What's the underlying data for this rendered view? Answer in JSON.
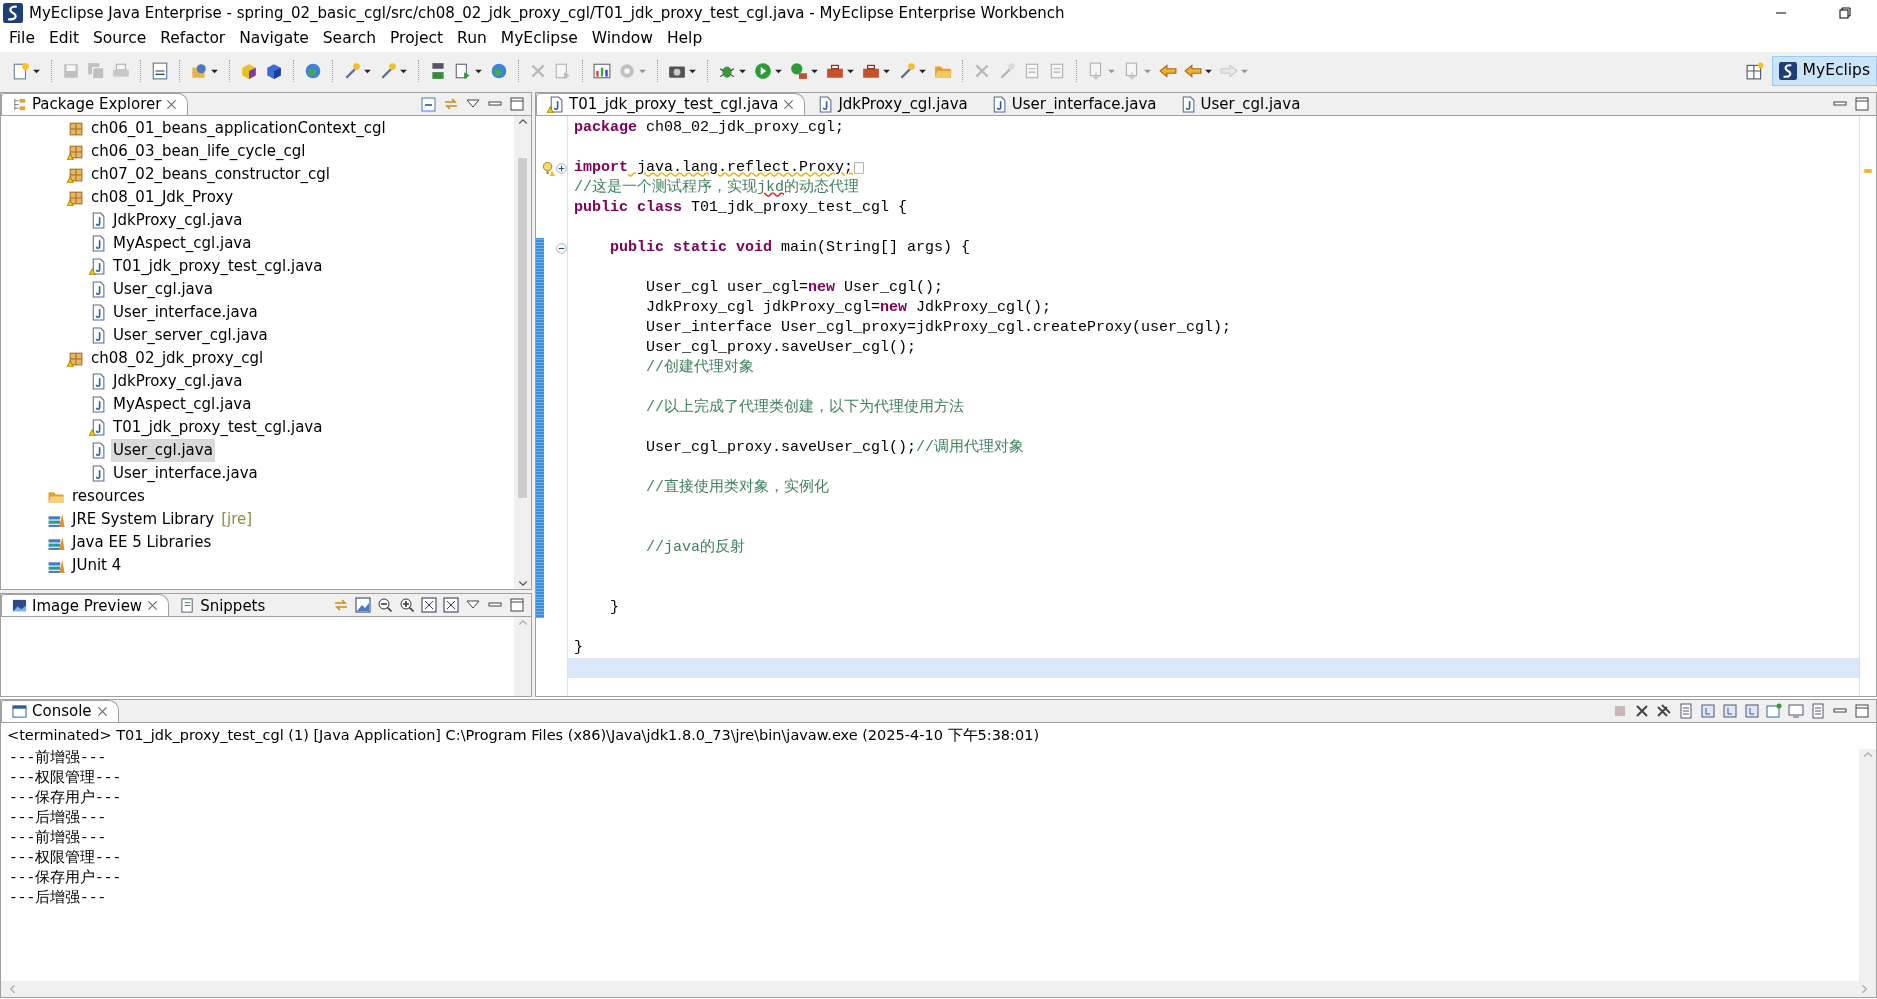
{
  "window": {
    "title": "MyEclipse Java Enterprise - spring_02_basic_cgl/src/ch08_02_jdk_proxy_cgl/T01_jdk_proxy_test_cgl.java - MyEclipse Enterprise Workbench"
  },
  "menu": [
    "File",
    "Edit",
    "Source",
    "Refactor",
    "Navigate",
    "Search",
    "Project",
    "Run",
    "MyEclipse",
    "Window",
    "Help"
  ],
  "toolbar": [
    {
      "kind": "new",
      "disabled": false,
      "dropdown": true
    },
    {
      "kind": "separator"
    },
    {
      "kind": "save",
      "disabled": true,
      "dropdown": false
    },
    {
      "kind": "saveall",
      "disabled": true,
      "dropdown": false
    },
    {
      "kind": "print",
      "disabled": true,
      "dropdown": false
    },
    {
      "kind": "separator"
    },
    {
      "kind": "binary",
      "disabled": false,
      "dropdown": false
    },
    {
      "kind": "separator"
    },
    {
      "kind": "project",
      "disabled": false,
      "dropdown": true
    },
    {
      "kind": "separator"
    },
    {
      "kind": "cube",
      "disabled": false,
      "dropdown": false
    },
    {
      "kind": "cubeblue",
      "disabled": false,
      "dropdown": false
    },
    {
      "kind": "separator"
    },
    {
      "kind": "globe",
      "disabled": false,
      "dropdown": false
    },
    {
      "kind": "separator"
    },
    {
      "kind": "wand",
      "disabled": false,
      "dropdown": true
    },
    {
      "kind": "wand",
      "disabled": false,
      "dropdown": true
    },
    {
      "kind": "separator"
    },
    {
      "kind": "server",
      "disabled": false,
      "dropdown": false
    },
    {
      "kind": "deploy",
      "disabled": false,
      "dropdown": true
    },
    {
      "kind": "globe",
      "disabled": false,
      "dropdown": false
    },
    {
      "kind": "separator"
    },
    {
      "kind": "cut",
      "disabled": true,
      "dropdown": false
    },
    {
      "kind": "deploy",
      "disabled": true,
      "dropdown": false
    },
    {
      "kind": "separator"
    },
    {
      "kind": "chart",
      "disabled": false,
      "dropdown": false
    },
    {
      "kind": "gear",
      "disabled": true,
      "dropdown": true
    },
    {
      "kind": "separator"
    },
    {
      "kind": "camera",
      "disabled": false,
      "dropdown": true
    },
    {
      "kind": "separator"
    },
    {
      "kind": "bug",
      "disabled": false,
      "dropdown": true
    },
    {
      "kind": "run",
      "disabled": false,
      "dropdown": true
    },
    {
      "kind": "runext",
      "disabled": false,
      "dropdown": true
    },
    {
      "kind": "tool",
      "disabled": false,
      "dropdown": true
    },
    {
      "kind": "tool",
      "disabled": false,
      "dropdown": true
    },
    {
      "kind": "wand",
      "disabled": false,
      "dropdown": true
    },
    {
      "kind": "folder",
      "disabled": false,
      "dropdown": false
    },
    {
      "kind": "separator"
    },
    {
      "kind": "cut",
      "disabled": true,
      "dropdown": false
    },
    {
      "kind": "wand",
      "disabled": true,
      "dropdown": false
    },
    {
      "kind": "box",
      "disabled": true,
      "dropdown": false
    },
    {
      "kind": "box",
      "disabled": true,
      "dropdown": false
    },
    {
      "kind": "separator"
    },
    {
      "kind": "annot",
      "disabled": true,
      "dropdown": true
    },
    {
      "kind": "annot",
      "disabled": true,
      "dropdown": true
    },
    {
      "kind": "back",
      "disabled": false,
      "dropdown": false
    },
    {
      "kind": "back",
      "disabled": false,
      "dropdown": true
    },
    {
      "kind": "forward",
      "disabled": true,
      "dropdown": true
    }
  ],
  "perspective": {
    "label": "MyEclips",
    "selected": true
  },
  "package_explorer": {
    "tab": {
      "label": "Package Explorer",
      "selected": true
    },
    "packages": [
      {
        "label": "ch06_01_beans_applicationContext_cgl",
        "warning": false,
        "selected": false
      },
      {
        "label": "ch06_03_bean_life_cycle_cgl",
        "warning": true,
        "selected": false
      },
      {
        "label": "ch07_02_beans_constructor_cgl",
        "warning": true,
        "selected": false
      },
      {
        "label": "ch08_01_Jdk_Proxy",
        "warning": true,
        "selected": false,
        "children": [
          {
            "label": "JdkProxy_cgl.java",
            "warning": false,
            "selected": false
          },
          {
            "label": "MyAspect_cgl.java",
            "warning": false,
            "selected": false
          },
          {
            "label": "T01_jdk_proxy_test_cgl.java",
            "warning": true,
            "selected": false
          },
          {
            "label": "User_cgl.java",
            "warning": false,
            "selected": false
          },
          {
            "label": "User_interface.java",
            "warning": false,
            "selected": false
          },
          {
            "label": "User_server_cgl.java",
            "warning": false,
            "selected": false
          }
        ]
      },
      {
        "label": "ch08_02_jdk_proxy_cgl",
        "warning": true,
        "selected": false,
        "children": [
          {
            "label": "JdkProxy_cgl.java",
            "warning": false,
            "selected": false
          },
          {
            "label": "MyAspect_cgl.java",
            "warning": false,
            "selected": false
          },
          {
            "label": "T01_jdk_proxy_test_cgl.java",
            "warning": true,
            "selected": false
          },
          {
            "label": "User_cgl.java",
            "warning": false,
            "selected": true
          },
          {
            "label": "User_interface.java",
            "warning": false,
            "selected": false
          }
        ]
      }
    ],
    "items": [
      {
        "label": "resources",
        "kind": "folder",
        "selected": false
      },
      {
        "label": "JRE System Library",
        "kind": "library",
        "decoration": "[jre]",
        "selected": false
      },
      {
        "label": "Java EE 5 Libraries",
        "kind": "library",
        "selected": false
      },
      {
        "label": "JUnit 4",
        "kind": "library",
        "selected": false
      }
    ]
  },
  "lower_left_tabs": [
    {
      "label": "Image Preview",
      "selected": true
    },
    {
      "label": "Snippets",
      "selected": false
    }
  ],
  "editor": {
    "tabs": [
      {
        "label": "T01_jdk_proxy_test_cgl.java",
        "selected": true,
        "warning": true
      },
      {
        "label": "JdkProxy_cgl.java",
        "selected": false,
        "warning": false
      },
      {
        "label": "User_interface.java",
        "selected": false,
        "warning": false
      },
      {
        "label": "User_cgl.java",
        "selected": false,
        "warning": false
      }
    ],
    "lines": [
      {
        "changed": false,
        "current": false,
        "segments": [
          {
            "text": "package",
            "kind": "keyword"
          },
          {
            "text": " ch08_02_jdk_proxy_cgl;",
            "kind": "plain"
          }
        ]
      },
      {
        "changed": false,
        "current": false
      },
      {
        "changed": false,
        "current": false,
        "warning": true,
        "foldable": true,
        "collapsed": true,
        "segments": [
          {
            "text": "import",
            "kind": "keyword"
          },
          {
            "text": " java.lang.reflect.Proxy;",
            "kind": "plain",
            "warning": true
          }
        ]
      },
      {
        "changed": false,
        "current": false,
        "segments": [
          {
            "text": "//这是一个测试程序，实现",
            "kind": "comment"
          },
          {
            "text": "jkd",
            "kind": "comment",
            "misspelled": true
          },
          {
            "text": "的动态代理",
            "kind": "comment"
          }
        ]
      },
      {
        "changed": false,
        "current": false,
        "segments": [
          {
            "text": "public",
            "kind": "keyword"
          },
          {
            "text": "class",
            "kind": "keyword"
          },
          {
            "text": " T01_jdk_proxy_test_cgl {",
            "kind": "plain"
          }
        ],
        "children": [
          {
            "changed": false,
            "current": false
          },
          {
            "changed": true,
            "current": false,
            "foldable": true,
            "collapsed": false,
            "segments": [
              {
                "text": "public",
                "kind": "keyword"
              },
              {
                "text": "static",
                "kind": "keyword"
              },
              {
                "text": "void",
                "kind": "keyword"
              },
              {
                "text": " main(String[] args) {",
                "kind": "plain"
              }
            ],
            "children": [
              {
                "changed": true,
                "current": false
              },
              {
                "changed": true,
                "current": false,
                "segments": [
                  {
                    "text": "User_cgl user_cgl=",
                    "kind": "plain"
                  },
                  {
                    "text": "new",
                    "kind": "keyword"
                  },
                  {
                    "text": " User_cgl();",
                    "kind": "plain"
                  }
                ]
              },
              {
                "changed": true,
                "current": false,
                "segments": [
                  {
                    "text": "JdkProxy_cgl jdkProxy_cgl=",
                    "kind": "plain"
                  },
                  {
                    "text": "new",
                    "kind": "keyword"
                  },
                  {
                    "text": " JdkProxy_cgl();",
                    "kind": "plain"
                  }
                ]
              },
              {
                "changed": true,
                "current": false,
                "segments": [
                  {
                    "text": "User_interface User_cgl_proxy=jdkProxy_cgl.createProxy(user_cgl);",
                    "kind": "plain"
                  }
                ]
              },
              {
                "changed": true,
                "current": false,
                "segments": [
                  {
                    "text": "User_cgl_proxy.saveUser_cgl();",
                    "kind": "plain"
                  }
                ]
              },
              {
                "changed": true,
                "current": false,
                "segments": [
                  {
                    "text": "//创建代理对象",
                    "kind": "comment"
                  }
                ]
              },
              {
                "changed": true,
                "current": false
              },
              {
                "changed": true,
                "current": false,
                "segments": [
                  {
                    "text": "//以上完成了代理类创建，以下为代理使用方法",
                    "kind": "comment"
                  }
                ]
              },
              {
                "changed": true,
                "current": false
              },
              {
                "changed": true,
                "current": false,
                "segments": [
                  {
                    "text": "User_cgl_proxy.saveUser_cgl();",
                    "kind": "plain"
                  },
                  {
                    "text": "//调用代理对象",
                    "kind": "comment"
                  }
                ]
              },
              {
                "changed": true,
                "current": false
              },
              {
                "changed": true,
                "current": false,
                "segments": [
                  {
                    "text": "//直接使用类对象，实例化",
                    "kind": "comment"
                  }
                ]
              },
              {
                "changed": true,
                "current": false
              },
              {
                "changed": true,
                "current": false
              },
              {
                "changed": true,
                "current": false,
                "segments": [
                  {
                    "text": "//java的反射",
                    "kind": "comment"
                  }
                ]
              },
              {
                "changed": true,
                "current": false
              },
              {
                "changed": true,
                "current": false
              }
            ]
          },
          {
            "changed": true,
            "current": false,
            "segments": [
              {
                "text": "}",
                "kind": "plain"
              }
            ]
          },
          {
            "changed": false,
            "current": false
          }
        ]
      },
      {
        "changed": false,
        "current": false,
        "segments": [
          {
            "text": "}",
            "kind": "plain"
          }
        ]
      },
      {
        "changed": false,
        "current": true
      }
    ]
  },
  "console": {
    "tab": {
      "label": "Console",
      "selected": true
    },
    "header": "<terminated> T01_jdk_proxy_test_cgl (1) [Java Application] C:\\Program Files (x86)\\Java\\jdk1.8.0_73\\jre\\bin\\javaw.exe (2025-4-10 下午5:38:01)",
    "lines": [
      "---前增强---",
      "---权限管理---",
      "---保存用户---",
      "---后增强---",
      "---前增强---",
      "---权限管理---",
      "---保存用户---",
      "---后增强---"
    ]
  }
}
